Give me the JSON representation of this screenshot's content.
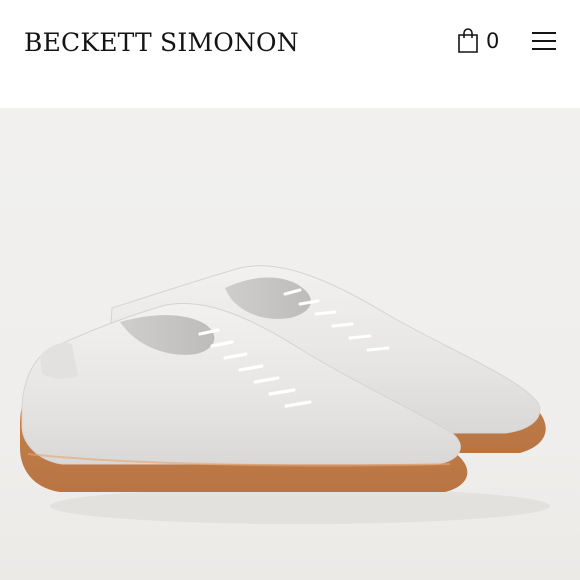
{
  "header": {
    "brand": "BECKETT SIMONON",
    "cart": {
      "icon": "shopping-bag-icon",
      "count": "0"
    },
    "menu_icon": "hamburger-menu-icon"
  },
  "hero": {
    "image": "white-leather-sneakers-gum-sole",
    "colors": {
      "background": "#efeeec",
      "upper": "#e9e8e6",
      "sole": "#c9854e"
    }
  }
}
